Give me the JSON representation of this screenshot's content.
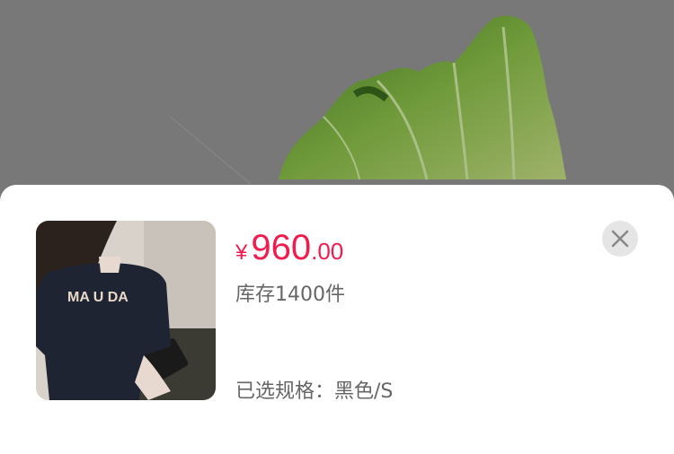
{
  "background": {
    "image": "napa-cabbage",
    "overlay_color": "#787878"
  },
  "sheet": {
    "product_image": "woman-in-navy-tshirt-photo",
    "price": {
      "currency": "¥",
      "integer": "960",
      "decimal": ".00",
      "color": "#f21b4e"
    },
    "stock_text": "库存1400件",
    "selected_spec_text": "已选规格：黑色/S",
    "close_icon": "close-icon"
  }
}
